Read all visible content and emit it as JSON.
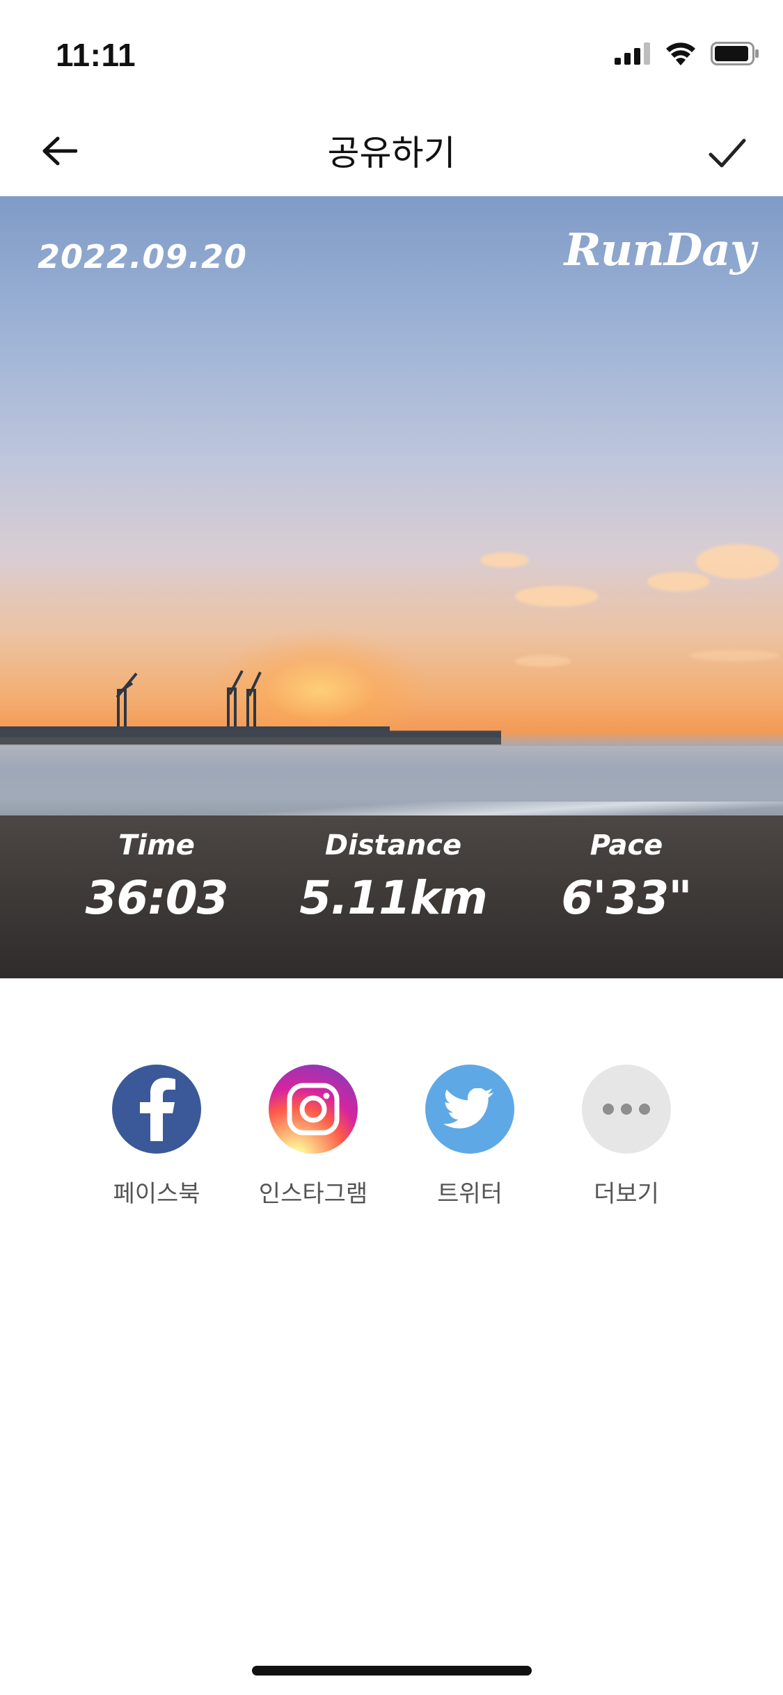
{
  "status_bar": {
    "time": "11:11",
    "icons": [
      "cellular-signal-icon",
      "wifi-icon",
      "battery-icon"
    ]
  },
  "nav": {
    "title": "공유하기",
    "back_icon": "arrow-left-icon",
    "confirm_icon": "checkmark-icon"
  },
  "photo_card": {
    "date": "2022.09.20",
    "brand": "RunDay",
    "stats": [
      {
        "label": "Time",
        "value": "36:03"
      },
      {
        "label": "Distance",
        "value": "5.11km"
      },
      {
        "label": "Pace",
        "value": "6'33\""
      }
    ]
  },
  "share": {
    "options": [
      {
        "label": "페이스북",
        "icon": "facebook-icon",
        "color": "#3b5998"
      },
      {
        "label": "인스타그램",
        "icon": "instagram-icon",
        "color": "#d6249f"
      },
      {
        "label": "트위터",
        "icon": "twitter-icon",
        "color": "#5ea8e6"
      },
      {
        "label": "더보기",
        "icon": "more-icon",
        "color": "#e6e6e6"
      }
    ]
  }
}
